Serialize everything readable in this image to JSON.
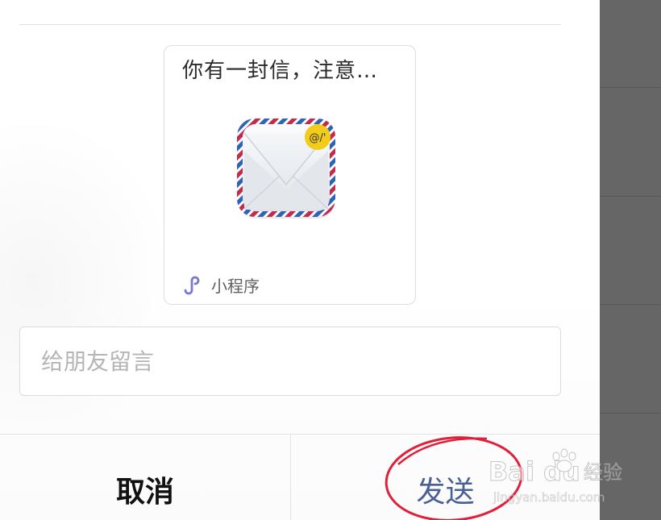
{
  "card": {
    "title": "你有一封信，注意…",
    "badge_text": "@/'",
    "mini_program_label": "小程序"
  },
  "message": {
    "placeholder": "给朋友留言",
    "value": ""
  },
  "footer": {
    "cancel_label": "取消",
    "send_label": "发送"
  },
  "watermark": {
    "brand_text": "Bai du",
    "experience_text": "经验",
    "url_text": "jingyan.baidu.com"
  },
  "colors": {
    "send_text": "#4a5f93",
    "annotation_circle": "#e0203a",
    "side_panel": "#666666",
    "mini_program_icon": "#7a79cf"
  },
  "icons": {
    "mail_app": "envelope-airmail-icon",
    "mini_program": "mini-program-icon"
  }
}
